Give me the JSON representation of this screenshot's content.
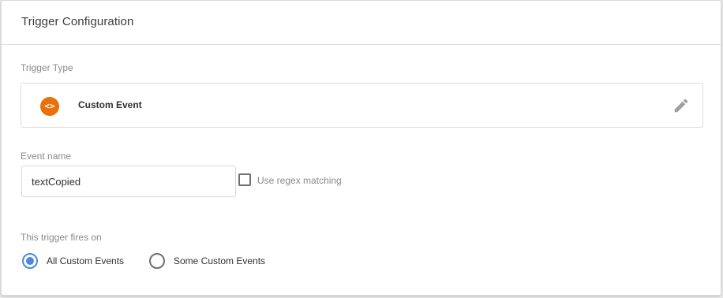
{
  "card": {
    "title": "Trigger Configuration"
  },
  "trigger_type": {
    "label": "Trigger Type",
    "name": "Custom Event",
    "icon": "code-brackets-icon",
    "icon_glyph": "<>",
    "icon_color": "#e8710a"
  },
  "event_name": {
    "label": "Event name",
    "value": "textCopied",
    "regex_label": "Use regex matching",
    "regex_checked": false
  },
  "fires_on": {
    "label": "This trigger fires on",
    "options": [
      {
        "label": "All Custom Events",
        "selected": true
      },
      {
        "label": "Some Custom Events",
        "selected": false
      }
    ],
    "accent_color": "#4a89dc"
  }
}
